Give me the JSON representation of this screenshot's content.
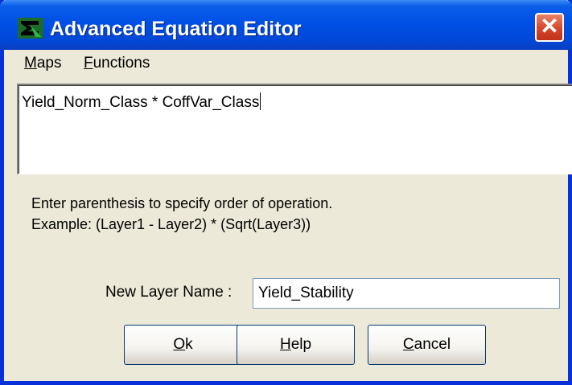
{
  "window": {
    "title": "Advanced Equation Editor",
    "close_glyph": "✕"
  },
  "menu": {
    "items": [
      {
        "first": "M",
        "rest": "aps"
      },
      {
        "first": "F",
        "rest": "unctions"
      }
    ]
  },
  "editor": {
    "value": "Yield_Norm_Class * CoffVar_Class"
  },
  "hints": {
    "line1": "Enter parenthesis to specify order of operation.",
    "line2": "Example: (Layer1 - Layer2) * (Sqrt(Layer3))"
  },
  "layer_name": {
    "label": "New Layer Name :",
    "value": "Yield_Stability"
  },
  "buttons": {
    "ok": {
      "first": "O",
      "rest": "k"
    },
    "help": {
      "first": "H",
      "rest": "elp"
    },
    "cancel": {
      "first": "C",
      "rest": "ancel"
    }
  },
  "colors": {
    "titlebar": "#0150e6",
    "face": "#ece9d8",
    "close": "#d4472a"
  },
  "icons": {
    "app": "sigma-map-icon",
    "close": "close-icon"
  }
}
